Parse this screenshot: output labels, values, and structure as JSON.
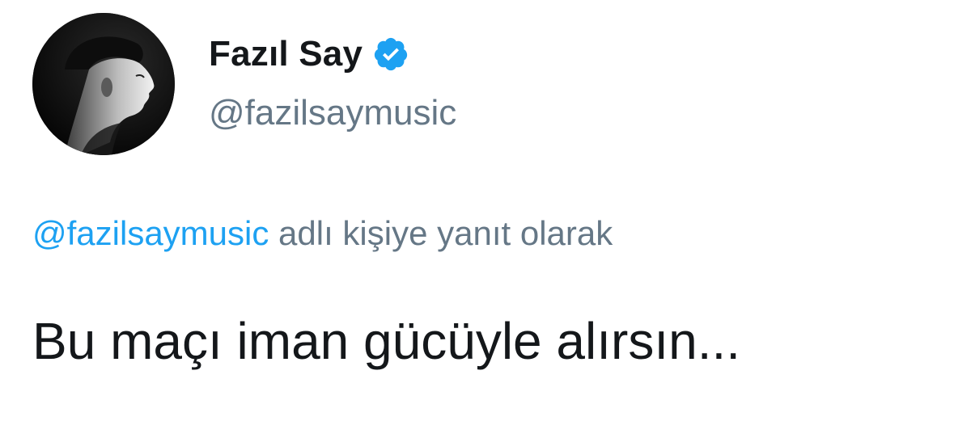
{
  "tweet": {
    "author": {
      "display_name": "Fazıl Say",
      "handle": "@fazilsaymusic",
      "verified": true,
      "avatar_icon": "profile-photo"
    },
    "reply_context": {
      "mention": "@fazilsaymusic",
      "suffix": "adlı kişiye yanıt olarak"
    },
    "text": "Bu maçı iman gücüyle alırsın..."
  },
  "colors": {
    "link": "#1da1f2",
    "secondary_text": "#657786",
    "primary_text": "#14171a",
    "background": "#ffffff"
  }
}
